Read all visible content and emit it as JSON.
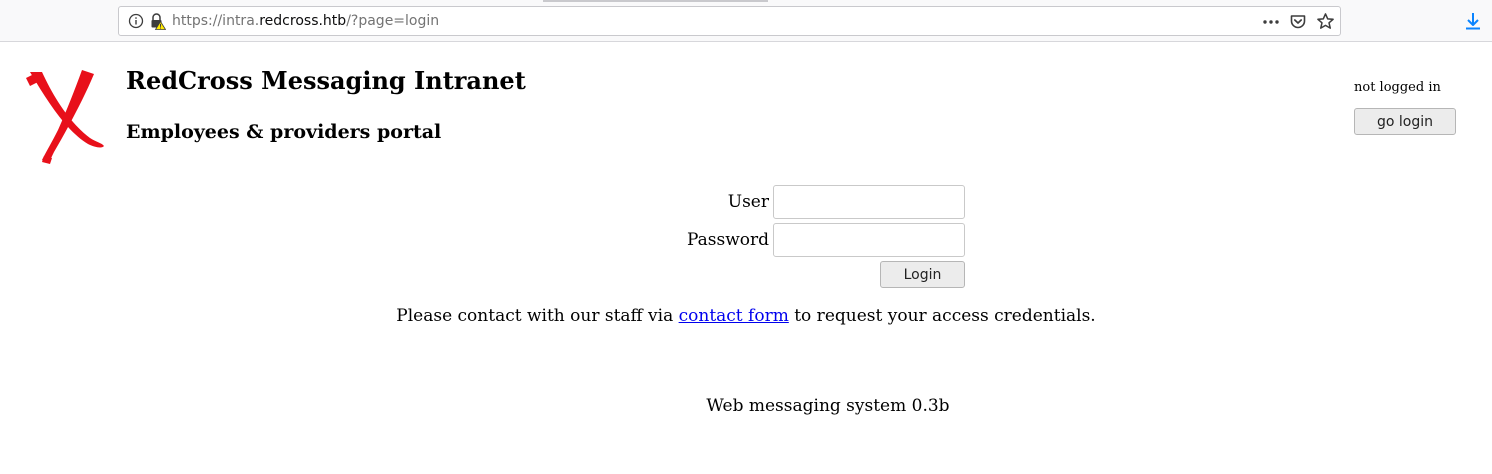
{
  "browser": {
    "url": {
      "prefix": "https://intra.",
      "host": "redcross.htb",
      "path": "/?page=login"
    },
    "icons": {
      "info": "info-icon",
      "lock": "insecure-lock-icon",
      "page_actions": "more-actions-icon",
      "pocket": "pocket-icon",
      "bookmark": "star-icon",
      "downloads": "download-icon"
    }
  },
  "header": {
    "title": "RedCross Messaging Intranet",
    "subtitle": "Employees & providers portal",
    "logo_color": "#e8101a"
  },
  "session": {
    "status": "not logged in",
    "go_login_label": "go login"
  },
  "login_form": {
    "user_label": "User",
    "user_value": "",
    "password_label": "Password",
    "password_value": "",
    "submit_label": "Login"
  },
  "contact": {
    "before": "Please contact with our staff via ",
    "link_text": "contact form",
    "after": " to request your access credentials.",
    "link_color": "#0000ee"
  },
  "footer": {
    "text": "Web messaging system 0.3b"
  }
}
